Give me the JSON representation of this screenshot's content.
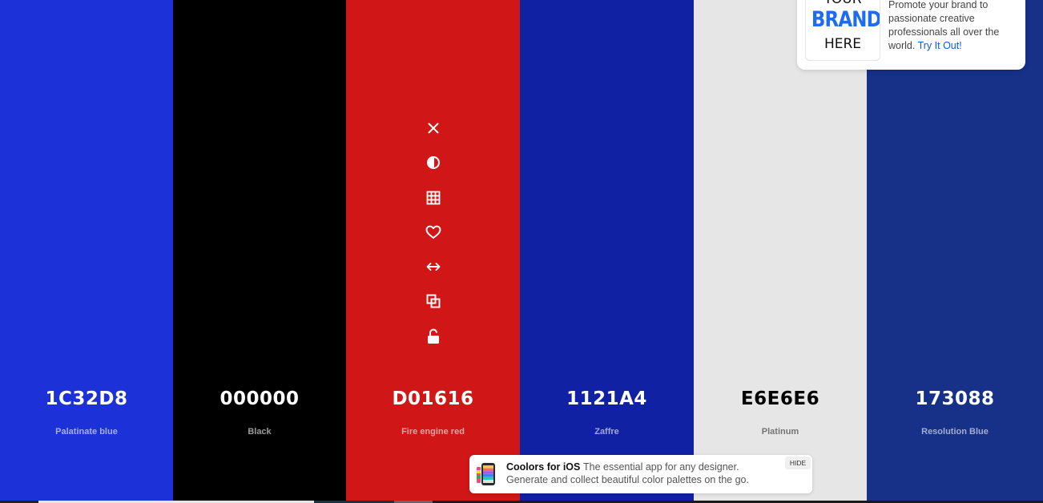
{
  "palette": {
    "swatches": [
      {
        "hex": "1C32D8",
        "name": "Palatinate blue",
        "color": "#1C32D8",
        "text_color": "#ffffff",
        "name_color": "rgba(255,255,255,0.6)"
      },
      {
        "hex": "000000",
        "name": "Black",
        "color": "#000000",
        "text_color": "#ffffff",
        "name_color": "rgba(255,255,255,0.6)"
      },
      {
        "hex": "D01616",
        "name": "Fire engine red",
        "color": "#D01616",
        "text_color": "#ffffff",
        "name_color": "rgba(255,255,255,0.6)"
      },
      {
        "hex": "1121A4",
        "name": "Zaffre",
        "color": "#1121A4",
        "text_color": "#ffffff",
        "name_color": "rgba(255,255,255,0.6)"
      },
      {
        "hex": "E6E6E6",
        "name": "Platinum",
        "color": "#E6E6E6",
        "text_color": "#000000",
        "name_color": "rgba(0,0,0,0.5)"
      },
      {
        "hex": "173088",
        "name": "Resolution Blue",
        "color": "#173088",
        "text_color": "#ffffff",
        "name_color": "rgba(255,255,255,0.6)"
      }
    ],
    "hovered_swatch_tools": [
      "close-icon",
      "contrast-icon",
      "shades-grid-icon",
      "heart-icon",
      "drag-arrows-icon",
      "copy-icon",
      "unlock-icon"
    ]
  },
  "ad": {
    "logo_line1": "YOUR",
    "logo_line2": "BRAND",
    "logo_line3": "HERE",
    "text": "Promote your brand to passionate creative professionals all over the world.",
    "link": "Try It Out!",
    "link_color": "#0f5bd8"
  },
  "ios_banner": {
    "title": "Coolors for iOS",
    "tagline": "The essential app for any designer.",
    "subtitle": "Generate and collect beautiful color palettes on the go.",
    "hide_label": "HIDE"
  }
}
